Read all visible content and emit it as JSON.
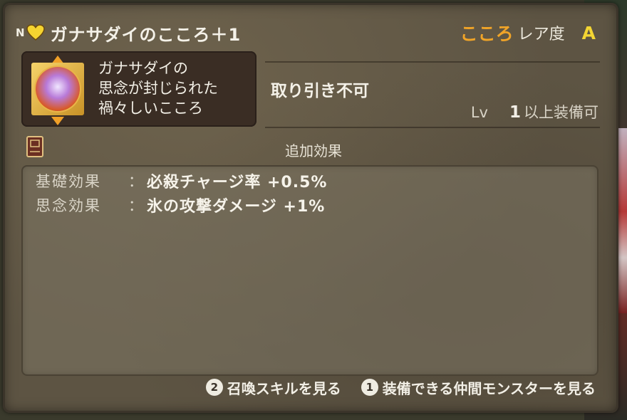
{
  "title": {
    "rank": "N",
    "item_name": "ガナサダイのこころ＋1",
    "type_label": "こころ",
    "rarity_label": "レア度",
    "rarity_grade": "A"
  },
  "description": {
    "lines": [
      "ガナサダイの",
      "思念が封じられた",
      "禍々しいこころ"
    ]
  },
  "trade_status": "取り引き不可",
  "level": {
    "label": "Lv",
    "value": "1",
    "suffix": "以上装備可"
  },
  "effects_title": "追加効果",
  "effects": [
    {
      "label": "基礎効果",
      "colon": "：",
      "value": "必殺チャージ率 +0.5%"
    },
    {
      "label": "思念効果",
      "colon": "：",
      "value": "氷の攻撃ダメージ +1%"
    }
  ],
  "footer": {
    "buttons": [
      {
        "number": "2",
        "label": "召喚スキルを見る"
      },
      {
        "number": "1",
        "label": "装備できる仲間モンスターを見る"
      }
    ]
  },
  "icons": {
    "heart": "yellow-heart-icon",
    "medal": "ganasadai-medal-icon",
    "book": "book-icon",
    "arrows": "up-down-arrow-icon"
  },
  "colors": {
    "heart": "#f5d430",
    "type_accent": "#f0a428",
    "grade": "#f3d533"
  }
}
